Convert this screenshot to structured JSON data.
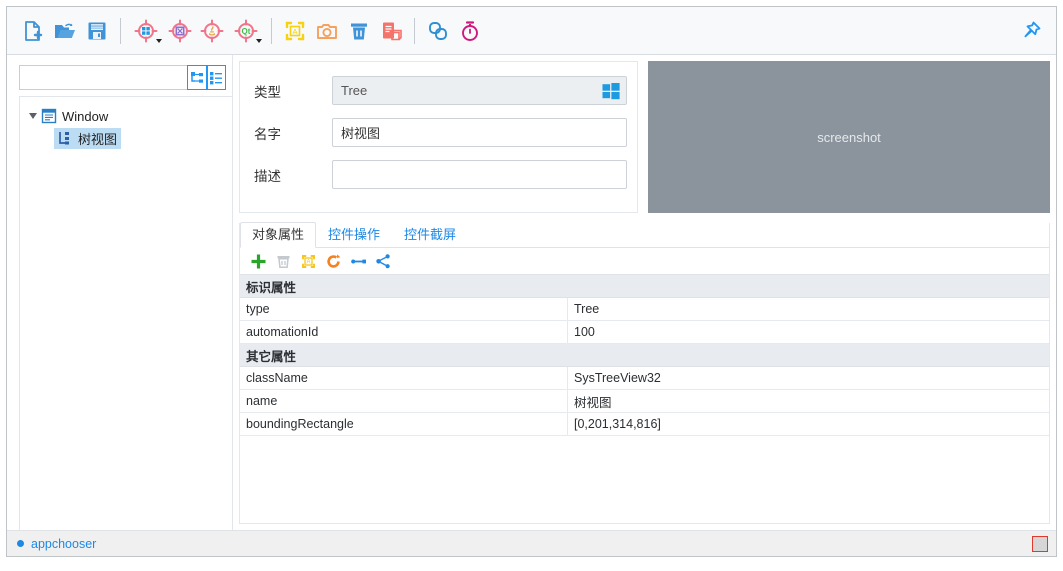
{
  "toolbar": {
    "buttons": [
      {
        "name": "new-file-icon",
        "label": "新建",
        "group": 0
      },
      {
        "name": "open-folder-icon",
        "label": "打开",
        "group": 0
      },
      {
        "name": "save-icon",
        "label": "保存",
        "group": 0
      },
      {
        "name": "capture-windows-icon",
        "label": "Windows 抓取",
        "group": 1,
        "dropdown": true
      },
      {
        "name": "capture-uia-icon",
        "label": "UIA 抓取",
        "group": 1,
        "dropdown": false
      },
      {
        "name": "capture-java-icon",
        "label": "Java 抓取",
        "group": 1,
        "dropdown": false
      },
      {
        "name": "capture-qt-icon",
        "label": "Qt 抓取",
        "group": 1,
        "dropdown": true
      },
      {
        "name": "highlight-element-icon",
        "label": "高亮元素",
        "group": 2
      },
      {
        "name": "screenshot-camera-icon",
        "label": "截屏",
        "group": 2
      },
      {
        "name": "delete-trash-icon",
        "label": "删除",
        "group": 2
      },
      {
        "name": "clipboard-copy-icon",
        "label": "复制",
        "group": 2
      },
      {
        "name": "link-chain-icon",
        "label": "关联",
        "group": 3
      },
      {
        "name": "stopwatch-timer-icon",
        "label": "计时",
        "group": 3
      }
    ],
    "pin": {
      "name": "pin-icon",
      "label": "固定"
    }
  },
  "left_panel": {
    "search": {
      "value": "",
      "placeholder": ""
    },
    "buttons": [
      {
        "name": "collapse-tree-icon",
        "label": "折叠树"
      },
      {
        "name": "expand-tree-icon",
        "label": "展开树"
      }
    ],
    "tree": [
      {
        "label": "Window",
        "icon": "window-node-icon",
        "level": 0,
        "expanded": true,
        "selected": false
      },
      {
        "label": "树视图",
        "icon": "tree-node-icon",
        "level": 1,
        "expanded": false,
        "selected": true
      }
    ]
  },
  "form": {
    "fields": [
      {
        "label": "类型",
        "value": "Tree",
        "placeholder": "",
        "readonly": true,
        "badge": "windows-logo-icon"
      },
      {
        "label": "名字",
        "value": "树视图",
        "placeholder": "",
        "readonly": false,
        "badge": ""
      },
      {
        "label": "描述",
        "value": "",
        "placeholder": "",
        "readonly": false,
        "badge": ""
      }
    ]
  },
  "screenshot_panel": {
    "label": "screenshot",
    "background": "#8b949c"
  },
  "tabs": [
    {
      "label": "对象属性",
      "active": true,
      "name": "tab-object-properties"
    },
    {
      "label": "控件操作",
      "active": false,
      "name": "tab-control-actions"
    },
    {
      "label": "控件截屏",
      "active": false,
      "name": "tab-control-screenshot"
    }
  ],
  "mini_toolbar": [
    {
      "name": "add-plus-icon",
      "label": "新增",
      "color": "#2aa52a"
    },
    {
      "name": "delete-trash-icon",
      "label": "删除",
      "color": "#b9bfc4"
    },
    {
      "name": "highlight-element-icon",
      "label": "高亮",
      "color": "#f5c518"
    },
    {
      "name": "refresh-icon",
      "label": "刷新",
      "color": "#f58220"
    },
    {
      "name": "bind-link-icon",
      "label": "绑定",
      "color": "#1e88e5"
    },
    {
      "name": "share-node-icon",
      "label": "分享",
      "color": "#1e88e5"
    }
  ],
  "properties": [
    {
      "type": "group",
      "label": "标识属性"
    },
    {
      "type": "row",
      "key": "type",
      "value": "Tree"
    },
    {
      "type": "row",
      "key": "automationId",
      "value": "100"
    },
    {
      "type": "group",
      "label": "其它属性"
    },
    {
      "type": "row",
      "key": "className",
      "value": "SysTreeView32"
    },
    {
      "type": "row",
      "key": "name",
      "value": "树视图"
    },
    {
      "type": "row",
      "key": "boundingRectangle",
      "value": "[0,201,314,816]"
    }
  ],
  "statusbar": {
    "text": "appchooser",
    "dot_color": "#1e88e5",
    "grip": {
      "name": "resize-grip",
      "border_color": "#e03a2f"
    }
  }
}
